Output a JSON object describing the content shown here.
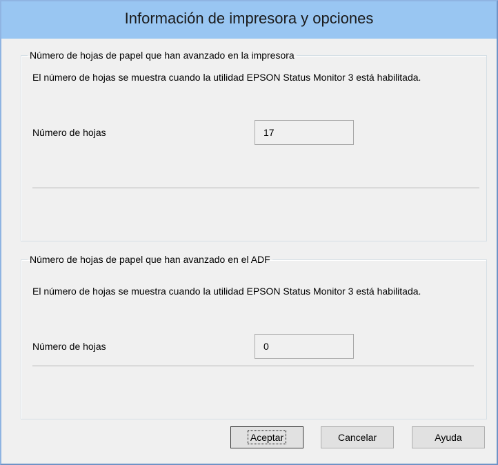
{
  "window": {
    "title": "Información de impresora y opciones"
  },
  "printer_group": {
    "legend": "Número de hojas de papel que han avanzado en la impresora",
    "description": "El número de hojas se muestra cuando la utilidad EPSON Status Monitor 3 está habilitada.",
    "count_label": "Número de hojas",
    "count_value": "17"
  },
  "adf_group": {
    "legend": "Número de hojas de papel que han avanzado en el ADF",
    "description": "El número de hojas se muestra cuando la utilidad EPSON Status Monitor 3 está habilitada.",
    "count_label": "Número de hojas",
    "count_value": "0"
  },
  "buttons": {
    "ok": "Aceptar",
    "cancel": "Cancelar",
    "help": "Ayuda"
  },
  "colors": {
    "titlebar": "#99c6f2",
    "window_border": "#8fb4e2",
    "dialog_background": "#f0f0f0"
  }
}
